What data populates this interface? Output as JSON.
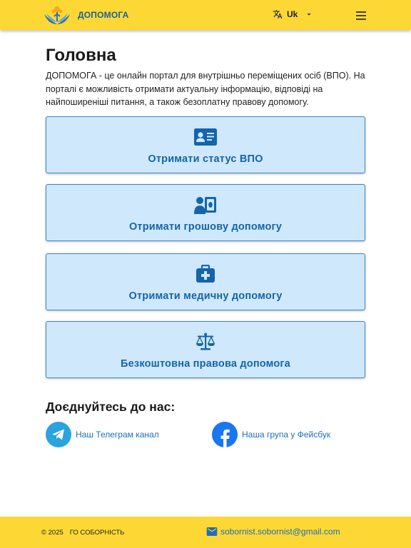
{
  "header": {
    "brand": "ДОПОМОГА",
    "language": "Uk",
    "icons": [
      "logo",
      "translate-icon",
      "caret-down-icon",
      "menu-icon"
    ]
  },
  "main": {
    "title": "Головна",
    "intro": "ДОПОМОГА - це онлайн портал для внутрішньо переміщених осіб (ВПО). На порталі є можливість отримати актуальну інформацію, відповіді на найпоширеніші питання, а також безоплатну правову допомогу.",
    "cards": [
      {
        "label": "Отримати статус ВПО",
        "icon": "id-card-icon"
      },
      {
        "label": "Отримати грошову допомогу",
        "icon": "money-hand-icon"
      },
      {
        "label": "Отримати медичну допомогу",
        "icon": "medical-kit-icon"
      },
      {
        "label": "Безкоштовна правова допомога",
        "icon": "scales-icon"
      }
    ],
    "join_title": "Доєднуйтесь до нас:",
    "social": [
      {
        "label": "Наш Телеграм канал",
        "icon": "telegram-icon"
      },
      {
        "label": "Наша група у Фейсбук",
        "icon": "facebook-icon"
      }
    ]
  },
  "footer": {
    "year": "© 2025",
    "org": "ГО СОБОРНІСТЬ",
    "email": "sobornist.sobornist@gmail.com"
  },
  "colors": {
    "header_bg": "#fdd835",
    "card_bg": "#cfe8fb",
    "card_border": "#3f86c6",
    "accent_blue": "#1565a8",
    "telegram": "#2aa3df",
    "facebook": "#1877f2"
  }
}
